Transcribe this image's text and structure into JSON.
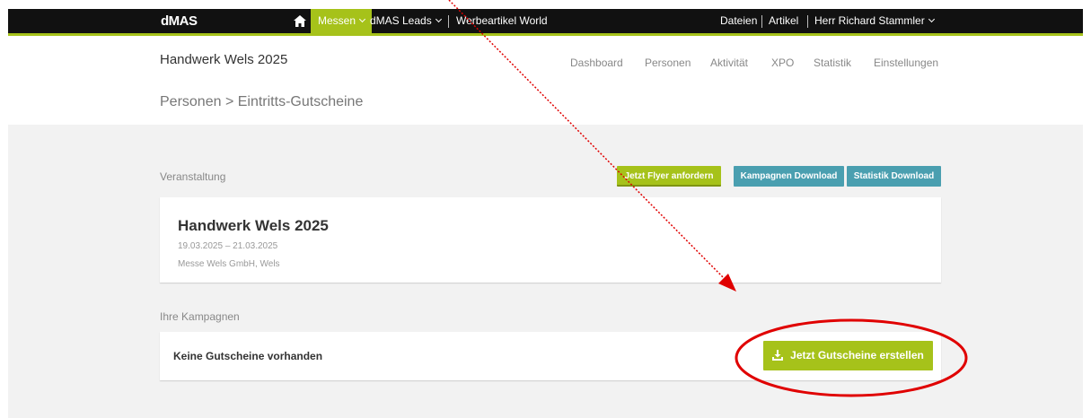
{
  "topbar": {
    "brand": "dMAS",
    "messen_label": "Messen",
    "leads_label": "dMAS Leads",
    "werbeartikel_label": "Werbeartikel World",
    "dateien_label": "Dateien",
    "artikel_label": "Artikel",
    "user_label": "Herr Richard Stammler",
    "accent_color": "#a6c21a"
  },
  "header": {
    "event_title": "Handwerk Wels 2025",
    "nav": {
      "dashboard": "Dashboard",
      "personen": "Personen",
      "aktivitaet": "Aktivität",
      "xpo": "XPO",
      "statistik": "Statistik",
      "einstellungen": "Einstellungen"
    },
    "breadcrumb": "Personen > Eintritts-Gutscheine"
  },
  "veranstaltung": {
    "label": "Veranstaltung",
    "flyer_button": "Jetzt Flyer anfordern",
    "kampagnen_button": "Kampagnen Download",
    "statistik_button": "Statistik Download",
    "event_name": "Handwerk Wels 2025",
    "event_dates": "19.03.2025 – 21.03.2025",
    "event_organizer": "Messe Wels GmbH, Wels"
  },
  "kampagnen": {
    "label": "Ihre Kampagnen",
    "empty_text": "Keine Gutscheine vorhanden",
    "create_button": "Jetzt Gutscheine erstellen"
  },
  "annotation": {
    "arrow_color": "#e00000",
    "circle_color": "#e00000"
  }
}
